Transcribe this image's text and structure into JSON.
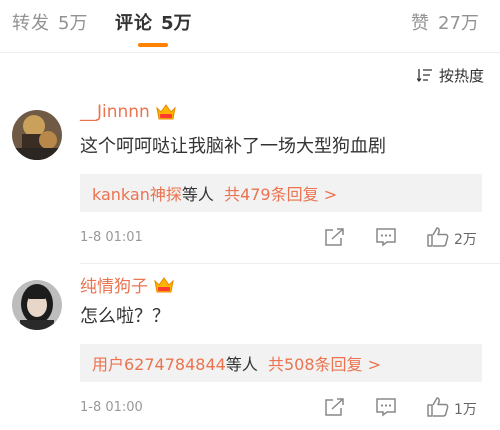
{
  "tabs": {
    "repost": {
      "label": "转发",
      "count": "5万"
    },
    "comment": {
      "label": "评论",
      "count": "5万"
    },
    "like": {
      "label": "赞",
      "count": "27万"
    }
  },
  "sort": {
    "label": "按热度",
    "icon": "sort-icon"
  },
  "comments": [
    {
      "username": "__Jinnnn",
      "text": "这个呵呵哒让我脑补了一场大型狗血剧",
      "replies_who": "kankan神探",
      "replies_mid": "等人",
      "replies_total": "共479条回复 >",
      "time": "1-8 01:01",
      "likes": "2万"
    },
    {
      "username": "纯情狗子",
      "text": "怎么啦？？",
      "replies_who": "用户6274784844",
      "replies_mid": "等人",
      "replies_total": "共508条回复 >",
      "time": "1-8 01:00",
      "likes": "1万"
    }
  ],
  "colors": {
    "accent": "#ff8200",
    "username": "#eb7350",
    "muted": "#999999"
  }
}
